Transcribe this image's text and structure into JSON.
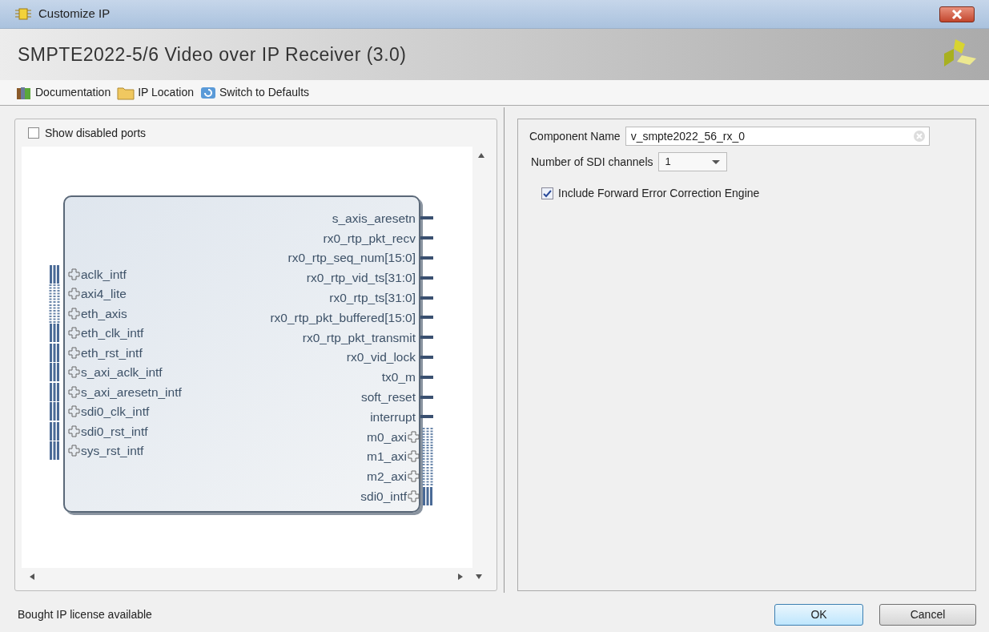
{
  "window": {
    "title": "Customize IP"
  },
  "header": {
    "title": "SMPTE2022-5/6 Video over IP Receiver (3.0)"
  },
  "toolbar": [
    {
      "kind": "books",
      "label": "Documentation"
    },
    {
      "kind": "folder",
      "label": "IP Location"
    },
    {
      "kind": "refresh",
      "label": "Switch to Defaults"
    }
  ],
  "symbol_panel": {
    "show_disabled_ports": {
      "label": "Show disabled ports",
      "checked": false
    },
    "left_ports": [
      {
        "name": "aclk_intf",
        "kind": "bus_solid"
      },
      {
        "name": "axi4_lite",
        "kind": "bus_dotted"
      },
      {
        "name": "eth_axis",
        "kind": "bus_dotted"
      },
      {
        "name": "eth_clk_intf",
        "kind": "bus_solid"
      },
      {
        "name": "eth_rst_intf",
        "kind": "bus_solid"
      },
      {
        "name": "s_axi_aclk_intf",
        "kind": "bus_solid"
      },
      {
        "name": "s_axi_aresetn_intf",
        "kind": "bus_solid"
      },
      {
        "name": "sdi0_clk_intf",
        "kind": "bus_solid"
      },
      {
        "name": "sdi0_rst_intf",
        "kind": "bus_solid"
      },
      {
        "name": "sys_rst_intf",
        "kind": "bus_solid"
      }
    ],
    "right_ports": [
      {
        "name": "s_axis_aresetn",
        "kind": "wire"
      },
      {
        "name": "rx0_rtp_pkt_recv",
        "kind": "wire"
      },
      {
        "name": "rx0_rtp_seq_num[15:0]",
        "kind": "wire"
      },
      {
        "name": "rx0_rtp_vid_ts[31:0]",
        "kind": "wire"
      },
      {
        "name": "rx0_rtp_ts[31:0]",
        "kind": "wire"
      },
      {
        "name": "rx0_rtp_pkt_buffered[15:0]",
        "kind": "wire"
      },
      {
        "name": "rx0_rtp_pkt_transmit",
        "kind": "wire"
      },
      {
        "name": "rx0_vid_lock",
        "kind": "wire"
      },
      {
        "name": "tx0_m",
        "kind": "wire"
      },
      {
        "name": "soft_reset",
        "kind": "wire"
      },
      {
        "name": "interrupt",
        "kind": "wire"
      },
      {
        "name": "m0_axi",
        "kind": "bus_dotted"
      },
      {
        "name": "m1_axi",
        "kind": "bus_dotted"
      },
      {
        "name": "m2_axi",
        "kind": "bus_dotted"
      },
      {
        "name": "sdi0_intf",
        "kind": "bus_solid"
      }
    ]
  },
  "settings": {
    "component_name": {
      "label": "Component Name",
      "value": "v_smpte2022_56_rx_0"
    },
    "sdi_channels": {
      "label": "Number of SDI channels",
      "value": "1"
    },
    "fec": {
      "label": "Include Forward Error Correction Engine",
      "checked": true
    }
  },
  "status_bar": {
    "text": "Bought IP license available"
  },
  "buttons": [
    {
      "label": "OK",
      "default": true
    },
    {
      "label": "Cancel",
      "default": false
    }
  ]
}
